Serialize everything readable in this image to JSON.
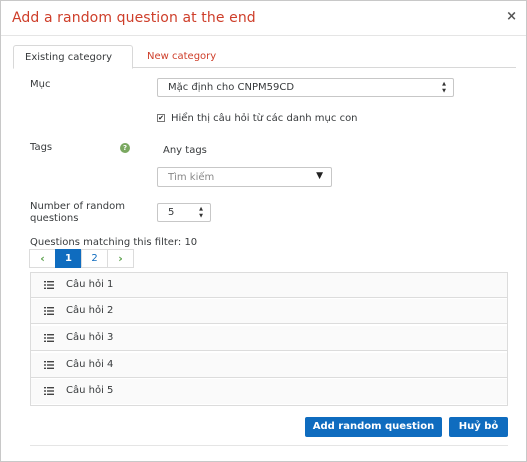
{
  "dialog": {
    "title": "Add a random question at the end",
    "close_glyph": "×"
  },
  "tabs": [
    {
      "label": "Existing category",
      "active": true
    },
    {
      "label": "New category",
      "active": false
    }
  ],
  "form": {
    "category_label": "Mục",
    "category_value": "Mặc định cho CNPM59CD",
    "include_subcategories_label": "Hiển thị câu hỏi từ các danh mục con",
    "include_subcategories_checked": true,
    "tags_label": "Tags",
    "tags_value": "Any tags",
    "tags_search_placeholder": "Tìm kiếm",
    "num_random_label_line1": "Number of random",
    "num_random_label_line2": "questions",
    "num_random_value": "5"
  },
  "matching": {
    "text": "Questions matching this filter: 10"
  },
  "pagination": {
    "prev": "‹",
    "pages": [
      "1",
      "2"
    ],
    "current": "1",
    "next": "›"
  },
  "questions": [
    "Câu hỏi 1",
    "Câu hỏi 2",
    "Câu hỏi 3",
    "Câu hỏi 4",
    "Câu hỏi 5"
  ],
  "buttons": {
    "add": "Add random question",
    "cancel": "Huỷ bỏ"
  },
  "colors": {
    "title_red": "#ce3e2a",
    "primary_blue": "#0f6cbf",
    "help_green": "#7aa860"
  },
  "icons": {
    "close": "close-icon",
    "help": "help-icon",
    "question": "question-list-icon",
    "dropdown": "chevron-down-icon"
  }
}
